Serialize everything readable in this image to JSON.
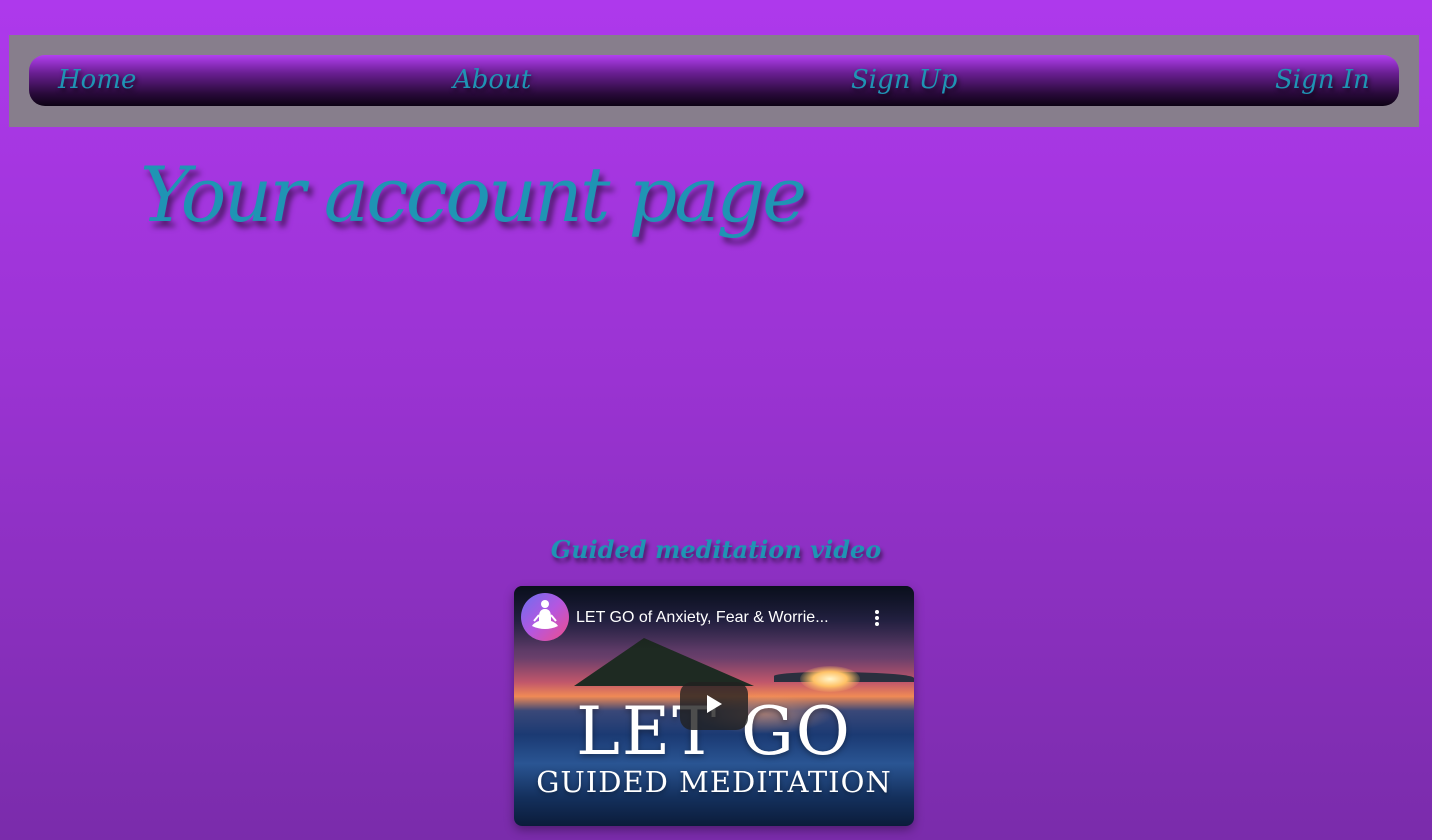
{
  "nav": {
    "items": [
      {
        "label": "Home"
      },
      {
        "label": "About"
      },
      {
        "label": "Sign Up"
      },
      {
        "label": "Sign In"
      }
    ]
  },
  "page": {
    "title": "Your account page"
  },
  "video_section": {
    "heading": "Guided meditation video",
    "video": {
      "title": "LET GO of Anxiety, Fear & Worrie...",
      "thumbnail_title": "LET GO",
      "thumbnail_subtitle": "GUIDED MEDITATION",
      "icons": [
        "meditation-avatar-icon",
        "more-options-icon",
        "play-icon"
      ]
    }
  },
  "colors": {
    "background_top": "#ae39ec",
    "background_bottom": "#7a2cab",
    "accent_text": "#1f94b4",
    "nav_frame": "#877e8c"
  }
}
